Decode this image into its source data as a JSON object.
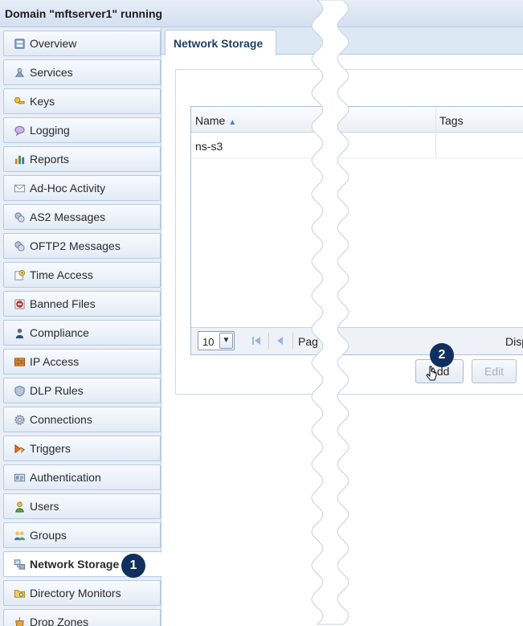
{
  "window": {
    "title": "Domain \"mftserver1\" running"
  },
  "sidebar": {
    "items": [
      {
        "label": "Overview",
        "icon": "overview-icon"
      },
      {
        "label": "Services",
        "icon": "services-icon"
      },
      {
        "label": "Keys",
        "icon": "key-icon"
      },
      {
        "label": "Logging",
        "icon": "logging-icon"
      },
      {
        "label": "Reports",
        "icon": "chart-icon"
      },
      {
        "label": "Ad-Hoc Activity",
        "icon": "envelope-icon"
      },
      {
        "label": "AS2 Messages",
        "icon": "messages-icon"
      },
      {
        "label": "OFTP2 Messages",
        "icon": "messages-icon"
      },
      {
        "label": "Time Access",
        "icon": "clock-icon"
      },
      {
        "label": "Banned Files",
        "icon": "banned-icon"
      },
      {
        "label": "Compliance",
        "icon": "user-icon"
      },
      {
        "label": "IP Access",
        "icon": "firewall-icon"
      },
      {
        "label": "DLP Rules",
        "icon": "shield-icon"
      },
      {
        "label": "Connections",
        "icon": "gear-icon"
      },
      {
        "label": "Triggers",
        "icon": "trigger-icon"
      },
      {
        "label": "Authentication",
        "icon": "card-icon"
      },
      {
        "label": "Users",
        "icon": "user-icon"
      },
      {
        "label": "Groups",
        "icon": "group-icon"
      },
      {
        "label": "Network Storage",
        "icon": "network-icon",
        "active": true
      },
      {
        "label": "Directory Monitors",
        "icon": "folder-icon"
      },
      {
        "label": "Drop Zones",
        "icon": "dropzone-icon"
      }
    ]
  },
  "main": {
    "tab": "Network Storage",
    "grid": {
      "columns": [
        "Name",
        "Tags"
      ],
      "rows": [
        {
          "name": "ns-s3",
          "tags": ""
        }
      ],
      "pager": {
        "page_size": "10",
        "page_label": "Pag",
        "display_label": "Disp"
      }
    },
    "buttons": {
      "add": "Add",
      "edit": "Edit"
    }
  },
  "callouts": [
    "1",
    "2"
  ],
  "colors": {
    "accent": "#0f2f5e",
    "border": "#b7c9e0",
    "active_text": "#1e3f66"
  }
}
